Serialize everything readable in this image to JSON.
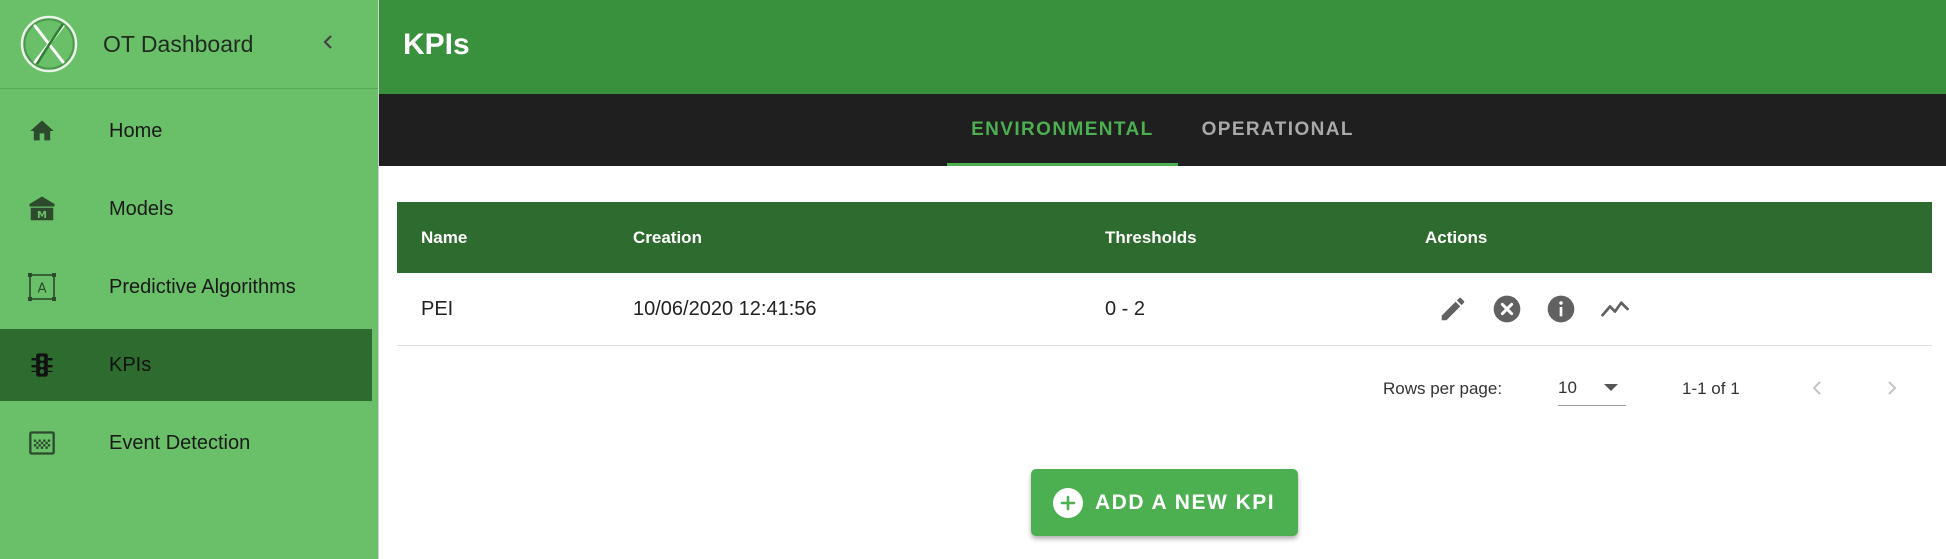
{
  "sidebar": {
    "app_title": "OT Dashboard",
    "items": [
      {
        "label": "Home",
        "icon": "home-icon"
      },
      {
        "label": "Models",
        "icon": "museum-icon"
      },
      {
        "label": "Predictive Algorithms",
        "icon": "selection-icon"
      },
      {
        "label": "KPIs",
        "icon": "traffic-light-icon",
        "active": true
      },
      {
        "label": "Event Detection",
        "icon": "grid-icon"
      }
    ]
  },
  "header": {
    "title": "KPIs"
  },
  "tabs": [
    {
      "label": "ENVIRONMENTAL",
      "active": true
    },
    {
      "label": "OPERATIONAL",
      "active": false
    }
  ],
  "table": {
    "columns": [
      "Name",
      "Creation",
      "Thresholds",
      "Actions"
    ],
    "rows": [
      {
        "name": "PEI",
        "creation": "10/06/2020 12:41:56",
        "thresholds": "0 - 2"
      }
    ]
  },
  "pagination": {
    "rows_per_page_label": "Rows per page:",
    "rows_per_page": "10",
    "range": "1-1 of 1"
  },
  "add_button": {
    "label": "ADD A NEW KPI"
  },
  "colors": {
    "sidebar_bg": "#6abf69",
    "sidebar_active": "#2e6b2e",
    "topbar": "#3a913d",
    "tabs_bg": "#1f1f1f",
    "accent": "#4caf50",
    "table_header": "#2e6b2e"
  }
}
